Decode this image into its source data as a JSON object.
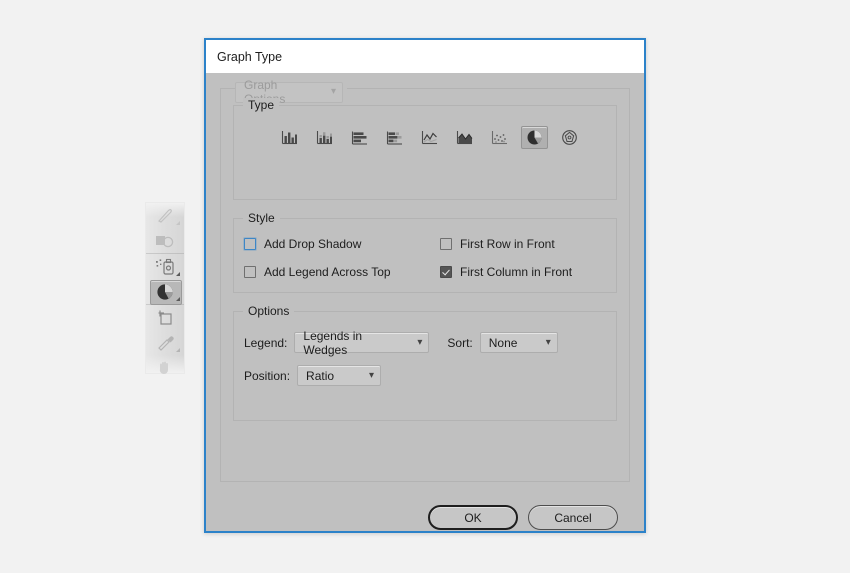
{
  "tool_panel": {
    "tools": [
      {
        "name": "paintbrush-tool",
        "selected": false,
        "has_flyout": true
      },
      {
        "name": "shape-builder-tool",
        "selected": false,
        "has_flyout": false
      },
      {
        "name": "symbol-sprayer-tool",
        "selected": false,
        "has_flyout": true
      },
      {
        "name": "graph-tool",
        "selected": true,
        "has_flyout": true
      },
      {
        "name": "artboard-tool",
        "selected": false,
        "has_flyout": false
      },
      {
        "name": "eyedropper-tool",
        "selected": false,
        "has_flyout": true
      },
      {
        "name": "hand-tool",
        "selected": false,
        "has_flyout": false
      }
    ]
  },
  "dialog": {
    "title": "Graph Type",
    "graph_options": {
      "label": "Graph Options",
      "selected": "Graph Options",
      "disabled": true
    },
    "type_group": {
      "legend": "Type",
      "buttons": [
        {
          "name": "column-graph",
          "selected": false
        },
        {
          "name": "stacked-column-graph",
          "selected": false
        },
        {
          "name": "bar-graph",
          "selected": false
        },
        {
          "name": "stacked-bar-graph",
          "selected": false
        },
        {
          "name": "line-graph",
          "selected": false
        },
        {
          "name": "area-graph",
          "selected": false
        },
        {
          "name": "scatter-graph",
          "selected": false
        },
        {
          "name": "pie-graph",
          "selected": true
        },
        {
          "name": "radar-graph",
          "selected": false
        }
      ]
    },
    "style_group": {
      "legend": "Style",
      "checkboxes": [
        {
          "name": "add-drop-shadow",
          "label": "Add Drop Shadow",
          "checked": false,
          "focused": true
        },
        {
          "name": "first-row-in-front",
          "label": "First Row in Front",
          "checked": false,
          "focused": false
        },
        {
          "name": "add-legend-across-top",
          "label": "Add Legend Across Top",
          "checked": false,
          "focused": false
        },
        {
          "name": "first-column-in-front",
          "label": "First Column in Front",
          "checked": true,
          "focused": false
        }
      ]
    },
    "options_group": {
      "legend": "Options",
      "legend_label": "Legend:",
      "legend_value": "Legends in Wedges",
      "sort_label": "Sort:",
      "sort_value": "None",
      "position_label": "Position:",
      "position_value": "Ratio"
    },
    "buttons": {
      "ok": "OK",
      "cancel": "Cancel"
    }
  },
  "colors": {
    "dialog_border": "#2c82c9",
    "dialog_body": "#c0c0c0",
    "title_bar": "#ffffff",
    "canvas": "#f2f2f2",
    "checkbox_focus": "#3d86c6",
    "checkbox_checked": "#555555"
  }
}
